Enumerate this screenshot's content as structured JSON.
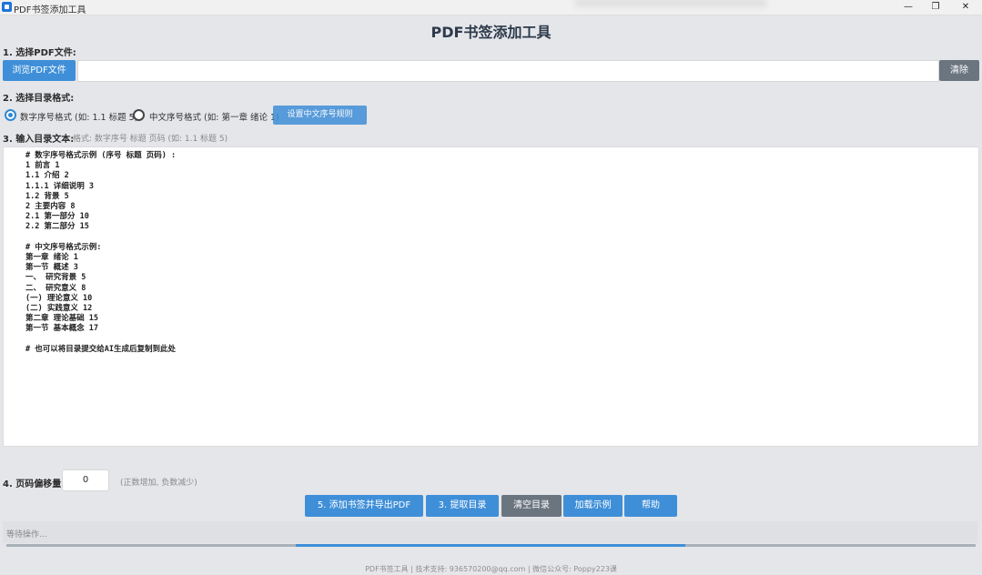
{
  "window": {
    "title": "PDF书签添加工具",
    "minimize": "—",
    "maximize": "❐",
    "close": "✕"
  },
  "header": {
    "title": "PDF书签添加工具"
  },
  "section1": {
    "label": "1. 选择PDF文件:",
    "browse": "浏览PDF文件",
    "path_value": "",
    "clear": "清除"
  },
  "section2": {
    "label": "2. 选择目录格式:",
    "radio_numeric": "数字序号格式 (如: 1.1 标题 5)",
    "radio_chinese": "中文序号格式 (如: 第一章 绪论 1)",
    "chinese_btn": "设置中文序号规则"
  },
  "section3": {
    "label": "3. 输入目录文本:",
    "hint": "格式: 数字序号 标题 页码 (如: 1.1 标题 5)",
    "text": "# 数字序号格式示例 (序号 标题 页码) :\n1 前言 1\n1.1 介绍 2\n1.1.1 详细说明 3\n1.2 背景 5\n2 主要内容 8\n2.1 第一部分 10\n2.2 第二部分 15\n\n# 中文序号格式示例:\n第一章 绪论 1\n第一节 概述 3\n一、 研究背景 5\n二、 研究意义 8\n(一) 理论意义 10\n(二) 实践意义 12\n第二章 理论基础 15\n第一节 基本概念 17\n\n# 也可以将目录提交给AI生成后复制到此处"
  },
  "section4": {
    "label": "4. 页码偏移量:",
    "offset_value": "0",
    "hint": "(正数增加, 负数减少)"
  },
  "actions": {
    "add": "5. 添加书签并导出PDF",
    "extract": "3. 提取目录",
    "clear_toc": "清空目录",
    "load_example": "加载示例",
    "help": "帮助"
  },
  "status": {
    "text": "等待操作...",
    "progress": 0.4
  },
  "footer": {
    "text": "PDF书签工具 | 技术支持: 936570200@qq.com | 微信公众号: Poppy223课"
  },
  "colors": {
    "accent": "#3f8fd8",
    "gray_button": "#6b7580",
    "title": "#2d3a4b"
  }
}
